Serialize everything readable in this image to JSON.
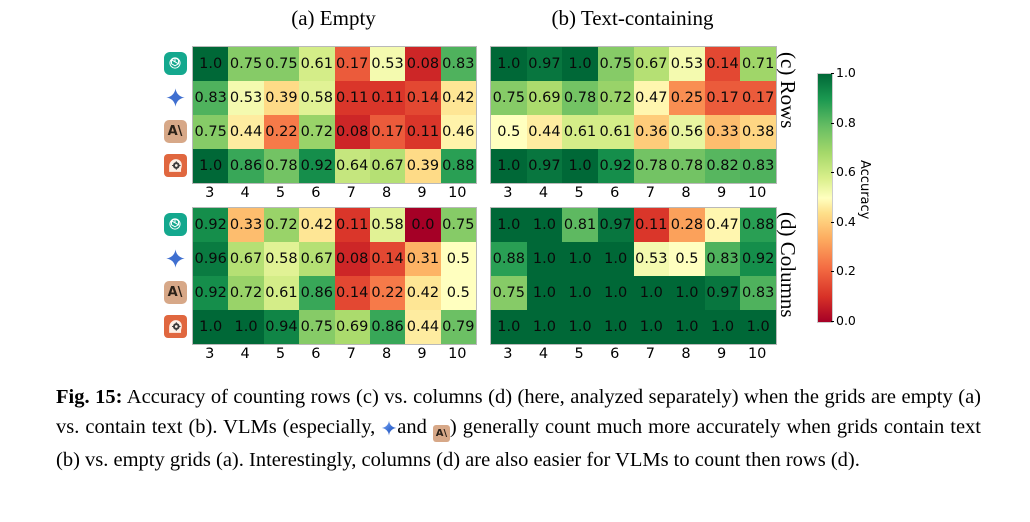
{
  "panels": {
    "a_title": "(a) Empty",
    "b_title": "(b) Text-containing",
    "c_label": "(c) Rows",
    "d_label": "(d) Columns"
  },
  "colorbar": {
    "title": "Accuracy",
    "ticks": [
      "1.0",
      "0.8",
      "0.6",
      "0.4",
      "0.2",
      "0.0"
    ],
    "low_color": "#a50026",
    "mid_color": "#ffffbf",
    "high_color": "#006837",
    "vmin": 0.0,
    "vmax": 1.0
  },
  "models": [
    {
      "name": "OpenAI",
      "icon": "openai-icon"
    },
    {
      "name": "Gemini",
      "icon": "gemini-star-icon"
    },
    {
      "name": "Anthropic",
      "icon": "anthropic-icon"
    },
    {
      "name": "Human",
      "icon": "human-head-gear-icon"
    }
  ],
  "chart_data": [
    {
      "type": "heatmap",
      "id": "rows-empty",
      "title": "(a) Empty",
      "row_group": "(c) Rows",
      "xlabel": "",
      "ylabel": "",
      "categories": [
        "3",
        "4",
        "5",
        "6",
        "7",
        "8",
        "9",
        "10"
      ],
      "rows": [
        "OpenAI",
        "Gemini",
        "Anthropic",
        "Human"
      ],
      "values": [
        [
          1.0,
          0.75,
          0.75,
          0.61,
          0.17,
          0.53,
          0.08,
          0.83
        ],
        [
          0.83,
          0.53,
          0.39,
          0.58,
          0.11,
          0.11,
          0.14,
          0.42
        ],
        [
          0.75,
          0.44,
          0.22,
          0.72,
          0.08,
          0.17,
          0.11,
          0.46
        ],
        [
          1.0,
          0.86,
          0.78,
          0.92,
          0.64,
          0.67,
          0.39,
          0.88
        ]
      ],
      "labels": [
        [
          "1.0",
          "0.75",
          "0.75",
          "0.61",
          "0.17",
          "0.53",
          "0.08",
          "0.83"
        ],
        [
          "0.83",
          "0.53",
          "0.39",
          "0.58",
          "0.11",
          "0.11",
          "0.14",
          "0.42"
        ],
        [
          "0.75",
          "0.44",
          "0.22",
          "0.72",
          "0.08",
          "0.17",
          "0.11",
          "0.46"
        ],
        [
          "1.0",
          "0.86",
          "0.78",
          "0.92",
          "0.64",
          "0.67",
          "0.39",
          "0.88"
        ]
      ],
      "cmap": "RdYlGn",
      "zlim": [
        0.0,
        1.0
      ]
    },
    {
      "type": "heatmap",
      "id": "rows-text",
      "title": "(b) Text-containing",
      "row_group": "(c) Rows",
      "xlabel": "",
      "ylabel": "",
      "categories": [
        "3",
        "4",
        "5",
        "6",
        "7",
        "8",
        "9",
        "10"
      ],
      "rows": [
        "OpenAI",
        "Gemini",
        "Anthropic",
        "Human"
      ],
      "values": [
        [
          1.0,
          0.97,
          1.0,
          0.75,
          0.67,
          0.53,
          0.14,
          0.71
        ],
        [
          0.75,
          0.69,
          0.78,
          0.72,
          0.47,
          0.25,
          0.17,
          0.17
        ],
        [
          0.5,
          0.44,
          0.61,
          0.61,
          0.36,
          0.56,
          0.33,
          0.38
        ],
        [
          1.0,
          0.97,
          1.0,
          0.92,
          0.78,
          0.78,
          0.82,
          0.83
        ]
      ],
      "labels": [
        [
          "1.0",
          "0.97",
          "1.0",
          "0.75",
          "0.67",
          "0.53",
          "0.14",
          "0.71"
        ],
        [
          "0.75",
          "0.69",
          "0.78",
          "0.72",
          "0.47",
          "0.25",
          "0.17",
          "0.17"
        ],
        [
          "0.5",
          "0.44",
          "0.61",
          "0.61",
          "0.36",
          "0.56",
          "0.33",
          "0.38"
        ],
        [
          "1.0",
          "0.97",
          "1.0",
          "0.92",
          "0.78",
          "0.78",
          "0.82",
          "0.83"
        ]
      ],
      "cmap": "RdYlGn",
      "zlim": [
        0.0,
        1.0
      ]
    },
    {
      "type": "heatmap",
      "id": "columns-empty",
      "title": "(a) Empty",
      "row_group": "(d) Columns",
      "xlabel": "",
      "ylabel": "",
      "categories": [
        "3",
        "4",
        "5",
        "6",
        "7",
        "8",
        "9",
        "10"
      ],
      "rows": [
        "OpenAI",
        "Gemini",
        "Anthropic",
        "Human"
      ],
      "values": [
        [
          0.92,
          0.33,
          0.72,
          0.42,
          0.11,
          0.58,
          0.0,
          0.75
        ],
        [
          0.96,
          0.67,
          0.58,
          0.67,
          0.08,
          0.14,
          0.31,
          0.5
        ],
        [
          0.92,
          0.72,
          0.61,
          0.86,
          0.14,
          0.22,
          0.42,
          0.5
        ],
        [
          1.0,
          1.0,
          0.94,
          0.75,
          0.69,
          0.86,
          0.44,
          0.79
        ]
      ],
      "labels": [
        [
          "0.92",
          "0.33",
          "0.72",
          "0.42",
          "0.11",
          "0.58",
          "0.0",
          "0.75"
        ],
        [
          "0.96",
          "0.67",
          "0.58",
          "0.67",
          "0.08",
          "0.14",
          "0.31",
          "0.5"
        ],
        [
          "0.92",
          "0.72",
          "0.61",
          "0.86",
          "0.14",
          "0.22",
          "0.42",
          "0.5"
        ],
        [
          "1.0",
          "1.0",
          "0.94",
          "0.75",
          "0.69",
          "0.86",
          "0.44",
          "0.79"
        ]
      ],
      "cmap": "RdYlGn",
      "zlim": [
        0.0,
        1.0
      ]
    },
    {
      "type": "heatmap",
      "id": "columns-text",
      "title": "(b) Text-containing",
      "row_group": "(d) Columns",
      "xlabel": "",
      "ylabel": "",
      "categories": [
        "3",
        "4",
        "5",
        "6",
        "7",
        "8",
        "9",
        "10"
      ],
      "rows": [
        "OpenAI",
        "Gemini",
        "Anthropic",
        "Human"
      ],
      "values": [
        [
          1.0,
          1.0,
          0.81,
          0.97,
          0.11,
          0.28,
          0.47,
          0.88
        ],
        [
          0.88,
          1.0,
          1.0,
          1.0,
          0.53,
          0.5,
          0.83,
          0.92
        ],
        [
          0.75,
          1.0,
          1.0,
          1.0,
          1.0,
          1.0,
          0.97,
          0.83
        ],
        [
          1.0,
          1.0,
          1.0,
          1.0,
          1.0,
          1.0,
          1.0,
          1.0
        ]
      ],
      "labels": [
        [
          "1.0",
          "1.0",
          "0.81",
          "0.97",
          "0.11",
          "0.28",
          "0.47",
          "0.88"
        ],
        [
          "0.88",
          "1.0",
          "1.0",
          "1.0",
          "0.53",
          "0.5",
          "0.83",
          "0.92"
        ],
        [
          "0.75",
          "1.0",
          "1.0",
          "1.0",
          "1.0",
          "1.0",
          "0.97",
          "0.83"
        ],
        [
          "1.0",
          "1.0",
          "1.0",
          "1.0",
          "1.0",
          "1.0",
          "1.0",
          "1.0"
        ]
      ],
      "cmap": "RdYlGn",
      "zlim": [
        0.0,
        1.0
      ]
    }
  ],
  "caption": {
    "figure_label": "Fig. 15:",
    "part1": " Accuracy of counting rows (c) vs. columns (d) (here, analyzed separately) when the grids are empty (a) vs. contain text (b). VLMs (especially, ",
    "part2": "and ",
    "part3": ") generally count much more accurately when grids contain text (b) vs. empty grids (a). Interestingly, columns (d) are also easier for VLMs to count then rows (d)."
  }
}
